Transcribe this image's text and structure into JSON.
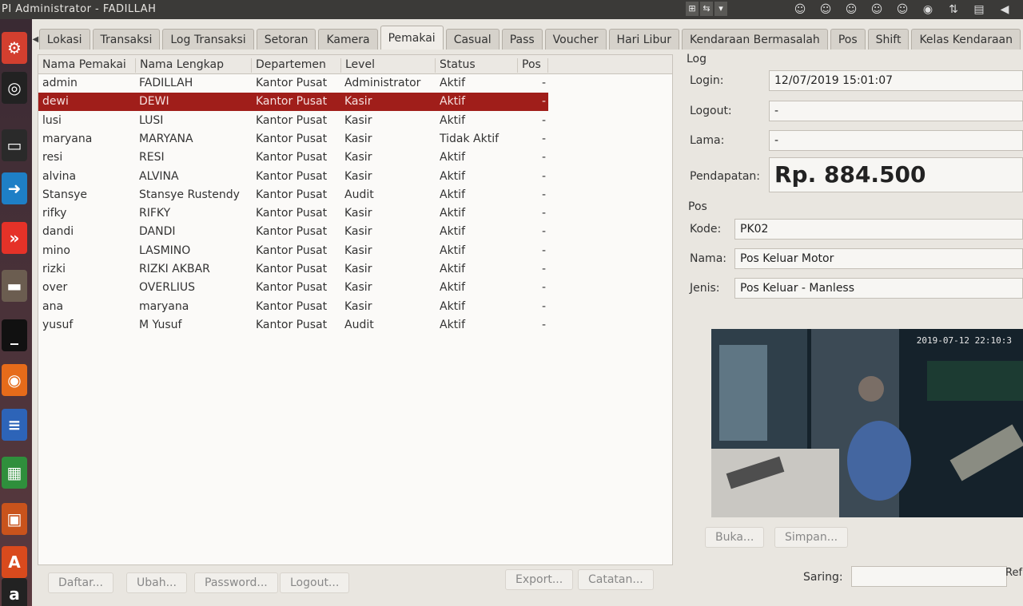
{
  "window": {
    "title": "PI Administrator - FADILLAH"
  },
  "titlebar": {
    "kb_keys": [
      "⊞",
      "⇆",
      "▾"
    ],
    "tray_icons": [
      "user-icon",
      "user-icon",
      "user-icon",
      "user-icon",
      "user-icon",
      "network-icon",
      "sort-icon",
      "keyboard-icon",
      "volume-icon"
    ]
  },
  "launcher": {
    "items": [
      "app-icon",
      "disc-icon",
      "monitor-icon",
      "arrow-icon",
      "forward-icon",
      "drive-icon",
      "terminal-icon",
      "firefox-icon",
      "document-icon",
      "spreadsheet-icon",
      "presentation-icon",
      "software-icon",
      "amazon-icon"
    ]
  },
  "tabs": [
    "Lokasi",
    "Transaksi",
    "Log Transaksi",
    "Setoran",
    "Kamera",
    "Pemakai",
    "Casual",
    "Pass",
    "Voucher",
    "Hari Libur",
    "Kendaraan Bermasalah",
    "Pos",
    "Shift",
    "Kelas Kendaraan"
  ],
  "active_tab": "Pemakai",
  "table": {
    "columns": [
      "Nama Pemakai",
      "Nama Lengkap",
      "Departemen",
      "Level",
      "Status",
      "Pos"
    ],
    "selected_row": 1,
    "rows": [
      [
        "admin",
        "FADILLAH",
        "Kantor Pusat",
        "Administrator",
        "Aktif",
        "-"
      ],
      [
        "dewi",
        "DEWI",
        "Kantor Pusat",
        "Kasir",
        "Aktif",
        "-"
      ],
      [
        "lusi",
        "LUSI",
        "Kantor Pusat",
        "Kasir",
        "Aktif",
        "-"
      ],
      [
        "maryana",
        "MARYANA",
        "Kantor Pusat",
        "Kasir",
        "Tidak Aktif",
        "-"
      ],
      [
        "resi",
        "RESI",
        "Kantor Pusat",
        "Kasir",
        "Aktif",
        "-"
      ],
      [
        "alvina",
        "ALVINA",
        "Kantor Pusat",
        "Kasir",
        "Aktif",
        "-"
      ],
      [
        "Stansye",
        "Stansye Rustendy",
        "Kantor Pusat",
        "Audit",
        "Aktif",
        "-"
      ],
      [
        "rifky",
        "RIFKY",
        "Kantor Pusat",
        "Kasir",
        "Aktif",
        "-"
      ],
      [
        "dandi",
        "DANDI",
        "Kantor Pusat",
        "Kasir",
        "Aktif",
        "-"
      ],
      [
        "mino",
        "LASMINO",
        "Kantor Pusat",
        "Kasir",
        "Aktif",
        "-"
      ],
      [
        "rizki",
        "RIZKI AKBAR",
        "Kantor Pusat",
        "Kasir",
        "Aktif",
        "-"
      ],
      [
        "over",
        "OVERLIUS",
        "Kantor Pusat",
        "Kasir",
        "Aktif",
        "-"
      ],
      [
        "ana",
        "maryana",
        "Kantor Pusat",
        "Kasir",
        "Aktif",
        "-"
      ],
      [
        "yusuf",
        "M Yusuf",
        "Kantor Pusat",
        "Audit",
        "Aktif",
        "-"
      ]
    ]
  },
  "log": {
    "section": "Log",
    "login_label": "Login:",
    "login_value": "12/07/2019 15:01:07",
    "logout_label": "Logout:",
    "logout_value": "-",
    "lama_label": "Lama:",
    "lama_value": "-",
    "pendapatan_label": "Pendapatan:",
    "pendapatan_value": "Rp. 884.500"
  },
  "pos": {
    "section": "Pos",
    "kode_label": "Kode:",
    "kode_value": "PK02",
    "nama_label": "Nama:",
    "nama_value": "Pos Keluar Motor",
    "jenis_label": "Jenis:",
    "jenis_value": "Pos Keluar - Manless"
  },
  "camera": {
    "timestamp": "2019-07-12 22:10:3"
  },
  "buttons": {
    "buka": "Buka...",
    "simpan": "Simpan...",
    "daftar": "Daftar...",
    "ubah": "Ubah...",
    "password": "Password...",
    "logout": "Logout...",
    "export": "Export...",
    "catatan": "Catatan...",
    "saring_label": "Saring:",
    "refresh": "Ref"
  },
  "colors": {
    "selected_row": "#a01e1a",
    "titlebar": "#3b3a38"
  }
}
